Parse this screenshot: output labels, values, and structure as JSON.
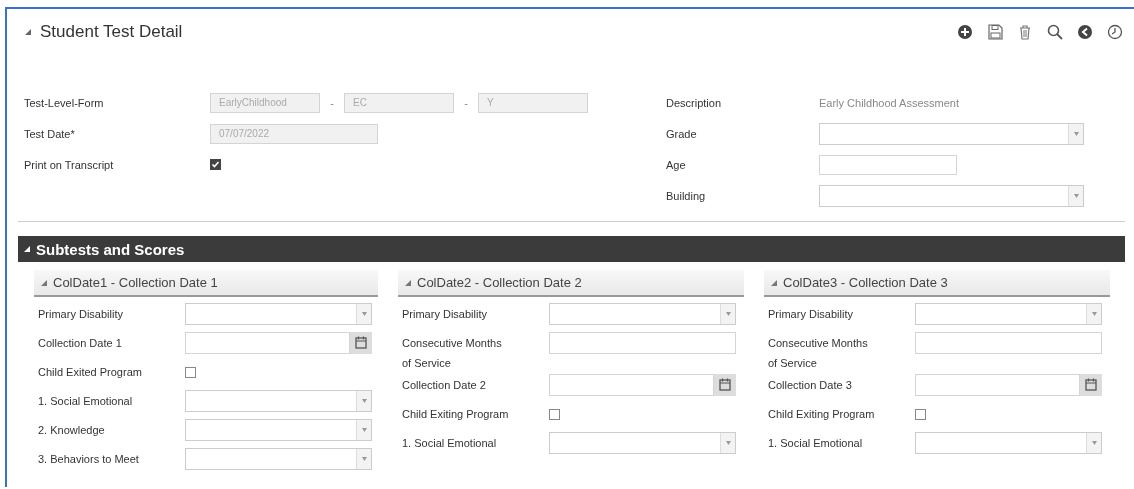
{
  "header": {
    "title": "Student Test Detail",
    "expanded": true
  },
  "test_form": {
    "left": [
      {
        "label": "Test-Level-Form",
        "kind": "multi",
        "items": [
          {
            "kind": "input",
            "value": "EarlyChildhood",
            "disabled": true
          },
          {
            "kind": "separator",
            "text": "-"
          },
          {
            "kind": "input",
            "value": "EC",
            "disabled": true
          },
          {
            "kind": "separator",
            "text": "-"
          },
          {
            "kind": "input",
            "value": "Y",
            "disabled": true
          }
        ]
      },
      {
        "label": "Test Date*",
        "kind": "input",
        "value": "07/07/2022",
        "disabled": true
      },
      {
        "label": "Print on Transcript",
        "kind": "checkbox",
        "checked": true
      }
    ],
    "right": [
      {
        "label": "Description",
        "kind": "static",
        "value": "Early Childhood Assessment"
      },
      {
        "label": "Grade",
        "kind": "select",
        "disabled": false
      },
      {
        "label": "Age",
        "kind": "input",
        "disabled": false
      },
      {
        "label": "Building",
        "kind": "select",
        "disabled": false
      }
    ]
  },
  "subtests": {
    "title": "Subtests and Scores",
    "expanded": true,
    "panels": [
      {
        "title": "ColDate1 - Collection Date 1",
        "expanded": true,
        "fields": [
          {
            "label": "Primary Disability",
            "kind": "select"
          },
          {
            "label": "Collection Date 1",
            "kind": "date"
          },
          {
            "label": "Child Exited Program",
            "kind": "checkbox",
            "checked": false
          },
          {
            "label": "1. Social Emotional",
            "kind": "select"
          },
          {
            "label": "2. Knowledge",
            "kind": "select"
          },
          {
            "label": "3. Behaviors to Meet",
            "kind": "select"
          }
        ]
      },
      {
        "title": "ColDate2 - Collection Date 2",
        "expanded": true,
        "fields": [
          {
            "label": "Primary Disability",
            "kind": "select"
          },
          {
            "label": "Consecutive Months of Service",
            "kind": "input"
          },
          {
            "label": "Collection Date 2",
            "kind": "date"
          },
          {
            "label": "Child Exiting Program",
            "kind": "checkbox",
            "checked": false
          },
          {
            "label": "1. Social Emotional",
            "kind": "select"
          }
        ]
      },
      {
        "title": "ColDate3 - Collection Date 3",
        "expanded": true,
        "fields": [
          {
            "label": "Primary Disability",
            "kind": "select"
          },
          {
            "label": "Consecutive Months of Service",
            "kind": "input"
          },
          {
            "label": "Collection Date 3",
            "kind": "date"
          },
          {
            "label": "Child Exiting Program",
            "kind": "checkbox",
            "checked": false
          },
          {
            "label": "1. Social Emotional",
            "kind": "select"
          }
        ]
      }
    ]
  }
}
